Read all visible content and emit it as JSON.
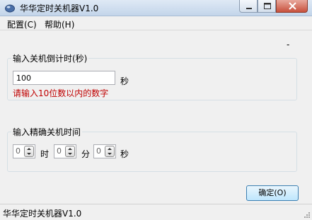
{
  "window": {
    "title": "华华定时关机器V1.0"
  },
  "menu": {
    "items": [
      {
        "label": "配置(C)"
      },
      {
        "label": "帮助(H)"
      }
    ]
  },
  "countdown_group": {
    "label": "输入关机倒计时(秒)",
    "dash": "-",
    "input_value": "100",
    "unit": "秒",
    "hint": "请输入10位数以内的数字"
  },
  "time_group": {
    "label": "输入精确关机时间",
    "hour_value": "0",
    "hour_unit": "时",
    "minute_value": "0",
    "minute_unit": "分",
    "second_value": "0",
    "second_unit": "秒"
  },
  "ok_button": {
    "label": "确定(O)"
  },
  "status": {
    "text": "华华定时关机器V1.0"
  },
  "colors": {
    "hint": "#c00000",
    "titlebar": "#c3d5ea",
    "close": "#c8503c"
  }
}
